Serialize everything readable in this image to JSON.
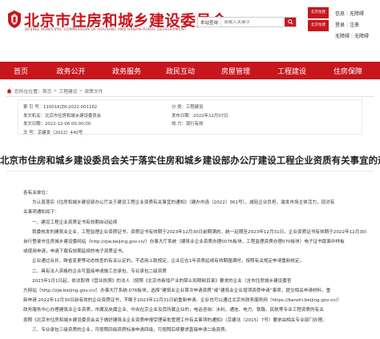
{
  "header": {
    "title": "北京市住房和城乡建设委员会",
    "subtitle": "BEIJING MUNICIPAL COMMISSION OF HOUSING AND URBAN-RURAL DEVELOPMENT",
    "search_scope": "本站查询",
    "search_placeholder": "请输入关键字",
    "badges": [
      "北京住建",
      "北京住建"
    ],
    "links": [
      [
        "信息",
        "无障碍"
      ],
      [
        "登录",
        "注册"
      ],
      [
        "无障碍",
        "无障碍"
      ]
    ]
  },
  "nav": {
    "items": [
      "首页",
      "政务公开",
      "政务服务",
      "政民互动",
      "房屋管理",
      "工程建设",
      "住房保障"
    ]
  },
  "breadcrumb": {
    "prefix": "您所在位置：",
    "items": [
      "首页",
      "工程建设",
      "政策文件"
    ]
  },
  "meta": {
    "rows": [
      [
        "索 引 号：110016/ZK-2022-001162",
        "分 类：工程建设"
      ],
      [
        "发文机关：北京市住房和城乡建设委员会",
        "发布日期：2022年12月07日"
      ],
      [
        "发文日期：2022-12-06 00:00:00",
        "效 力：现行有效"
      ],
      [
        "文    号：京建发〔2022〕440号",
        ""
      ]
    ]
  },
  "article": {
    "title": "北京市住房和城乡建设委员会关于落实住房和城乡建设部办公厅建设工程企业资质有关事宜的通知",
    "paragraphs": [
      {
        "text": "各有关单位：",
        "indent": false
      },
      {
        "text": "为认真落实《住房和城乡建设部办公厅关于建设工程企业资质有关事宜的通知》（建办市函〔2022〕361号），减轻企业负担，激发市场主体活力，现对有",
        "indent": true
      },
      {
        "text": "关事项通知如下：",
        "indent": false
      },
      {
        "text": "一、建设工程企业资质证书有效期自动延续",
        "indent": true
      },
      {
        "text": "我委核发的建筑业企业、工程监理企业资质证书，资质证书有效期于2023年12月30日前期满的，统一延期至2023年12月31日。企业资质证书有效期于2022年12月30日前，",
        "indent": true
      },
      {
        "text": "自行登录市住房城乡建设委网站（http://zjw.beijing.gov.cn/）办事大厅系统（建筑业企业资质办理0076板块，工程监理资质办理070板块）电子证书版面中样板",
        "indent": false
      },
      {
        "text": "或使用申请，申请下载有效期延续的电子资质证书。",
        "indent": false
      },
      {
        "text": "企业通过合并、跨省变更等动态核查的有关认定的，不适用上款规定，企业应在1年资质延续有效期届满时，按照有关规定申请重新核定。",
        "indent": true
      },
      {
        "text": "二、具有法人资格的企业可直接申请施工总承包、专业承包二级资质",
        "indent": true
      },
      {
        "text": "2023年1月1日起，依法取得《营业执照》的法人（按照《北京市新增产业的禁止和限制目录》要求的企业（含市住房城乡建设委官",
        "indent": true
      },
      {
        "text": "方网站（http://zjw.beijing.gov.cn/）办事大厅系统-076板块，选择“建筑业企业首次申请资质”或“建筑业企业增项资质申请”事项，提交相关申请材料，重",
        "indent": false
      },
      {
        "text": "新申请 2022年12月30日前有效的企业资质证书，不晚于2023年12月31日前重新申请。企业也可以通过北京市政务服务网（https://banshi.beijing.gov.cn/）",
        "indent": false
      },
      {
        "text": "政务服务中心办理建筑业企业资质，市属及央属企业、中央在京企业及其所属企业的，电话咨询：水利、通信、电力、铁路、民航等专业工程资质的有关",
        "indent": false
      },
      {
        "text": "按照《北京市住房和城乡建设委员会关于做好建筑业企业资质申报受理审批管理工作有关事项的通知》（京建法〔2015〕7号）要求由相关专业部门办理。",
        "indent": false
      },
      {
        "text": "三、专业承包三级资质的企业，可按照四级资质标准申请四级，可按照后续要求直接申请二级资质。",
        "indent": true
      }
    ]
  },
  "colors": {
    "brand_red": "#c8161d",
    "link_blue": "#1a5fb4"
  }
}
